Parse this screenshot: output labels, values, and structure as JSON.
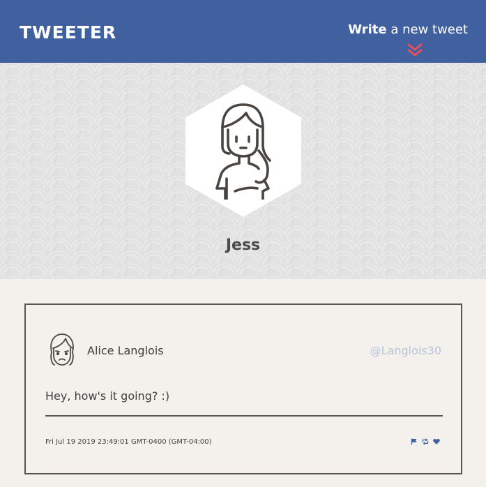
{
  "nav": {
    "brand": "TWEETER",
    "compose_bold": "Write",
    "compose_rest": " a new tweet",
    "compose_icon": "double-chevron-down-icon"
  },
  "profile": {
    "name": "Jess",
    "avatar_icon": "girl-long-hair-avatar-icon"
  },
  "tweets": [
    {
      "author": "Alice Langlois",
      "handle": "@Langlois30",
      "text": "Hey, how's it going? :)",
      "timestamp": "Fri Jul 19 2019 23:49:01 GMT-0400 (GMT-04:00)",
      "avatar_icon": "girl-sad-avatar-icon",
      "actions": [
        "flag-icon",
        "retweet-icon",
        "heart-icon"
      ]
    }
  ],
  "colors": {
    "nav_bg": "#4060a0",
    "accent": "#e8505b",
    "page_bg": "#f4f1ec",
    "handle": "#b9c2de",
    "action_icons": "#4060a0"
  }
}
